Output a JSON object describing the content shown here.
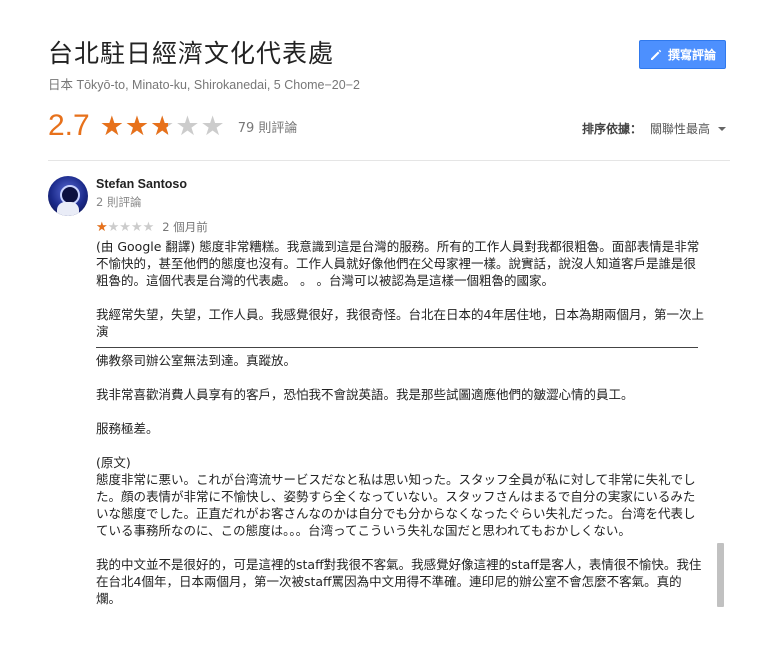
{
  "header": {
    "title": "台北駐日經濟文化代表處",
    "address": "日本 Tōkyō-to, Minato-ku, Shirokanedai, 5 Chome−20−2",
    "write_review_label": "撰寫評論",
    "write_review_icon": "pencil-icon"
  },
  "rating": {
    "value": "2.7",
    "stars_fraction": 0.54,
    "count_label": "79 則評論",
    "accent_color": "#e7711b"
  },
  "sort": {
    "label": "排序依據：",
    "value": "關聯性最高"
  },
  "review": {
    "author": "Stefan Santoso",
    "author_meta": "2 則評論",
    "stars": 1,
    "date": "2 個月前",
    "paragraphs": {
      "p1": "(由 Google 翻譯) 態度非常糟糕。我意識到這是台灣的服務。所有的工作人員對我都很粗魯。面部表情是非常不愉快的，甚至他們的態度也沒有。工作人員就好像他們在父母家裡一樣。說實話，說沒人知道客戶是誰是很粗魯的。這個代表是台灣的代表處。 。 。台灣可以被認為是這樣一個粗魯的國家。",
      "p2": "我經常失望，失望，工作人員。我感覺很好，我很奇怪。台北在日本的4年居住地，日本為期兩個月，第一次上演",
      "p3": "佛教祭司辦公室無法到達。真蹤放。",
      "p4": "我非常喜歡消費人員享有的客戶，恐怕我不會說英語。我是那些試圖適應他們的皺澀心情的員工。",
      "p5": "服務極差。",
      "original_label": "(原文)",
      "p6": "態度非常に悪い。これが台湾流サービスだなと私は思い知った。スタッフ全員が私に対して非常に失礼でした。顔の表情が非常に不愉快し、姿勢すら全くなっていない。スタッフさんはまるで自分の実家にいるみたいな態度でした。正直だれがお客さんなのかは自分でも分からなくなったぐらい失礼だった。台湾を代表している事務所なのに、この態度は。。。台湾ってこういう失礼な国だと思われてもおかしくない。",
      "p7": "我的中文並不是很好的，可是這裡的staff對我很不客氣。我感覺好像這裡的staff是客人，表情很不愉快。我住在台北4個年，日本兩個月，第一次被staff罵因為中文用得不準確。連印尼的辦公室不會怎麼不客氣。真的爛。"
    }
  }
}
